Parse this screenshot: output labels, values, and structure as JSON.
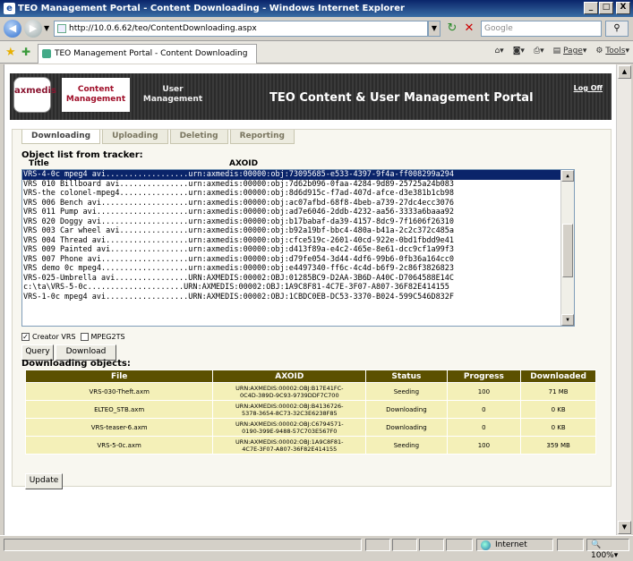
{
  "window": {
    "title": "TEO Management Portal - Content Downloading - Windows Internet Explorer",
    "minimize": "_",
    "maximize": "□",
    "close": "X"
  },
  "browser": {
    "url": "http://10.0.6.62/teo/ContentDownloading.aspx",
    "search_placeholder": "Google",
    "tab_title": "TEO Management Portal - Content Downloading",
    "page_label": "Page",
    "tools_label": "Tools"
  },
  "portal": {
    "logo_text": "axmedis",
    "tabs": [
      {
        "line1": "Content",
        "line2": "Management"
      },
      {
        "line1": "User",
        "line2": "Management"
      }
    ],
    "title": "TEO Content & User Management Portal",
    "logoff": "Log Off"
  },
  "subtabs": [
    "Downloading",
    "Uploading",
    "Deleting",
    "Reporting"
  ],
  "object_list": {
    "heading": "Object list from tracker:",
    "col_title": "Title",
    "col_axoid": "AXOID",
    "rows": [
      "VRS-4-0c mpeg4 avi..................urn:axmedis:00000:obj:73095685-e533-4397-9f4a-ff008299a294",
      "VRS 010 Billboard avi...............urn:axmedis:00000:obj:7d62b096-0faa-4284-9d89-25725a24b083",
      "VRS-the colonel-mpeg4...............urn:axmedis:00000:obj:8d6d915c-f7ad-407d-afce-d3e381b1cb98",
      "VRS 006 Bench avi...................urn:axmedis:00000:obj:ac07afbd-68f8-4beb-a739-27dc4ecc3076",
      "VRS 011 Pump avi....................urn:axmedis:00000:obj:ad7e6046-2ddb-4232-aa56-3333a6baaa92",
      "VRS 020 Doggy avi...................urn:axmedis:00000:obj:b17babaf-da39-4157-8dc9-7f1606f26310",
      "VRS 003 Car wheel avi...............urn:axmedis:00000:obj:b92a19bf-bbc4-480a-b41a-2c2c372c485a",
      "VRS 004 Thread avi..................urn:axmedis:00000:obj:cfce519c-2601-40cd-922e-0bd1fbdd9e41",
      "VRS 009 Painted avi.................urn:axmedis:00000:obj:d413f89a-e4c2-465e-8e61-dcc9cf1a99f3",
      "VRS 007 Phone avi...................urn:axmedis:00000:obj:d79fe054-3d44-4df6-99b6-0fb36a164cc0",
      "VRS demo 0c mpeg4...................urn:axmedis:00000:obj:e4497340-ff6c-4c4d-b6f9-2c86f3826823",
      "VRS-025-Umbrella avi................URN:AXMEDIS:00002:OBJ:01285BC9-D2AA-3B6D-A40C-D7064588E14C",
      "c:\\ta\\VRS-5-0c.....................URN:AXMEDIS:00002:OBJ:1A9C8F81-4C7E-3F07-A807-36F82E414155",
      "VRS-1-0c mpeg4 avi..................URN:AXMEDIS:00002:OBJ:1CBDC0EB-DC53-3370-B024-599C546D832F"
    ]
  },
  "options": {
    "creator_vrs_label": "Creator VRS",
    "creator_vrs_checked": true,
    "mpeg2ts_label": "MPEG2TS",
    "mpeg2ts_checked": false,
    "query_button": "Query",
    "download_button": "Download"
  },
  "downloading": {
    "heading": "Downloading objects:",
    "columns": [
      "File",
      "AXOID",
      "Status",
      "Progress",
      "Downloaded"
    ],
    "rows": [
      {
        "file": "VRS-030-Theft.axm",
        "axoid1": "URN:AXMEDIS:00002:OBJ:B17E41FC-",
        "axoid2": "0C4D-389D-9C93-9739DDF7C700",
        "status": "Seeding",
        "progress": "100",
        "downloaded": "71 MB"
      },
      {
        "file": "ELTEO_STB.axm",
        "axoid1": "URN:AXMEDIS:00002:OBJ:B4136726-",
        "axoid2": "5378-3654-8C73-32C3E6238F85",
        "status": "Downloading",
        "progress": "0",
        "downloaded": "0 KB"
      },
      {
        "file": "VRS-teaser-6.axm",
        "axoid1": "URN:AXMEDIS:00002:OBJ:C6794571-",
        "axoid2": "0190-399E-9488-57C703E567F0",
        "status": "Downloading",
        "progress": "0",
        "downloaded": "0 KB"
      },
      {
        "file": "VRS-5-0c.axm",
        "axoid1": "URN:AXMEDIS:00002:OBJ:1A9C8F81-",
        "axoid2": "4C7E-3F07-A807-36F82E414155",
        "status": "Seeding",
        "progress": "100",
        "downloaded": "359 MB"
      }
    ],
    "update_button": "Update"
  },
  "statusbar": {
    "zone": "Internet",
    "zoom": "100%"
  }
}
